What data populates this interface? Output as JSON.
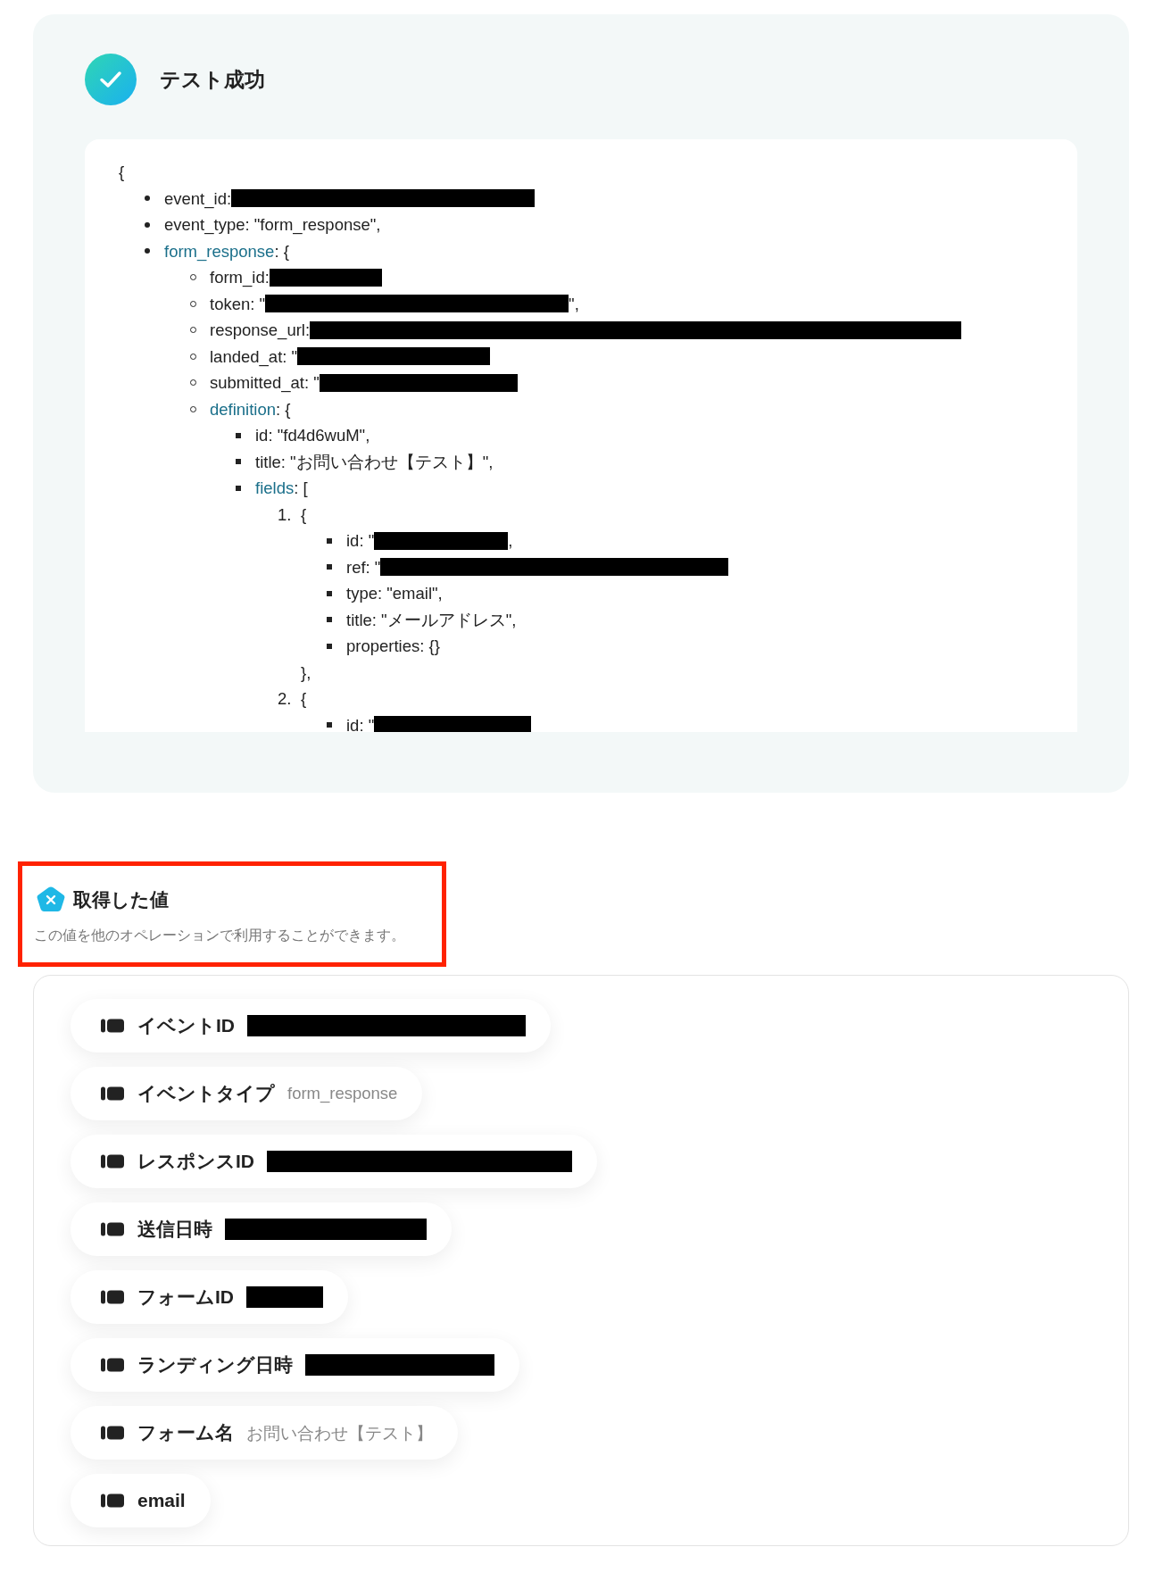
{
  "test_result": {
    "title": "テスト成功",
    "code": {
      "open": "{",
      "items": [
        {
          "kind": "disc",
          "text": "event_id: ",
          "redacted": true
        },
        {
          "kind": "disc",
          "text": "event_type: \"form_response\","
        },
        {
          "kind": "disc",
          "key": "form_response",
          "text": ": {",
          "children": [
            {
              "kind": "circle",
              "text": "form_id: ",
              "redacted": true
            },
            {
              "kind": "circle",
              "text": "token: \"",
              "redacted": true,
              "suffix": "\","
            },
            {
              "kind": "circle",
              "text": "response_url: ",
              "redacted": true
            },
            {
              "kind": "circle",
              "text": "landed_at: \"",
              "redacted": true
            },
            {
              "kind": "circle",
              "text": "submitted_at: \"",
              "redacted": true
            },
            {
              "kind": "circle",
              "key": "definition",
              "text": ": {",
              "children": [
                {
                  "kind": "square",
                  "text": "id: \"fd4d6wuM\","
                },
                {
                  "kind": "square",
                  "text": "title: \"お問い合わせ【テスト】\","
                },
                {
                  "kind": "square",
                  "key": "fields",
                  "text": ": [",
                  "children": [
                    {
                      "kind": "ordered",
                      "marker": "1.",
                      "text": "{",
                      "close": "},",
                      "children": [
                        {
                          "kind": "square",
                          "text": "id: \"",
                          "redacted": true,
                          "suffix": ","
                        },
                        {
                          "kind": "square",
                          "text": "ref: \"",
                          "redacted": true
                        },
                        {
                          "kind": "square",
                          "text": "type: \"email\","
                        },
                        {
                          "kind": "square",
                          "text": "title: \"メールアドレス\","
                        },
                        {
                          "kind": "square",
                          "text": "properties: {}"
                        }
                      ]
                    },
                    {
                      "kind": "ordered",
                      "marker": "2.",
                      "text": "{",
                      "children": [
                        {
                          "kind": "square",
                          "text": "id: \"",
                          "redacted": true
                        }
                      ]
                    }
                  ]
                }
              ]
            }
          ]
        }
      ]
    }
  },
  "retrieved_values": {
    "title": "取得した値",
    "description": "この値を他のオペレーションで利用することができます。",
    "highlighted": true,
    "items": [
      {
        "label": "イベントID",
        "redacted": true
      },
      {
        "label": "イベントタイプ",
        "value": "form_response"
      },
      {
        "label": "レスポンスID",
        "redacted": true
      },
      {
        "label": "送信日時",
        "redacted": true
      },
      {
        "label": "フォームID",
        "redacted": true
      },
      {
        "label": "ランディング日時",
        "redacted": true
      },
      {
        "label": "フォーム名",
        "value": "お問い合わせ【テスト】"
      },
      {
        "label": "email"
      }
    ]
  }
}
